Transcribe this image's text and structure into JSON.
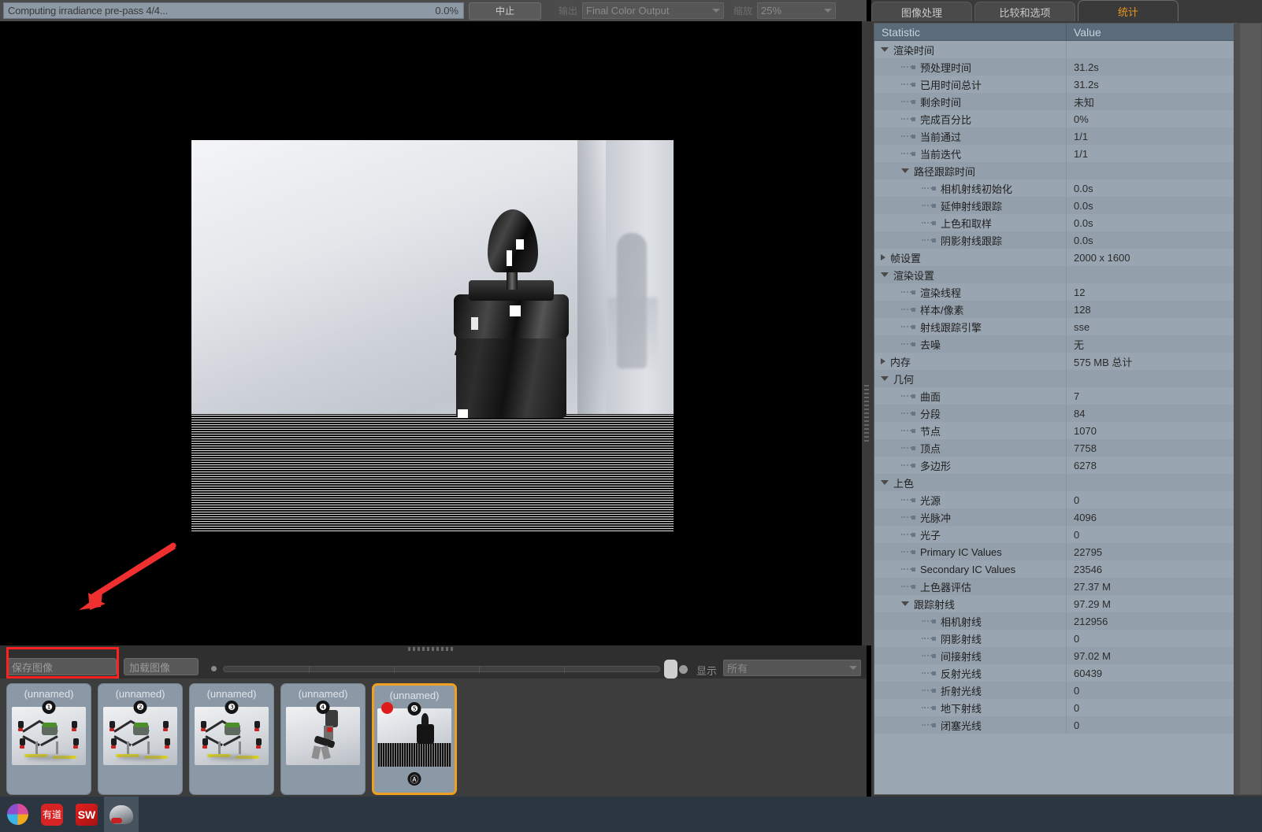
{
  "topbar": {
    "progress_text": "Computing irradiance pre-pass 4/4...",
    "progress_percent": "0.0%",
    "progress_value": 0,
    "abort_label": "中止",
    "output_label": "输出",
    "output_value": "Final Color Output",
    "zoom_label": "缩放",
    "zoom_value": "25%"
  },
  "toolbar": {
    "save_image_label": "保存图像",
    "load_image_label": "加载图像",
    "show_label": "显示",
    "show_value": "所有"
  },
  "thumbnails": [
    {
      "title": "(unnamed)",
      "number": "❶",
      "kind": "drone",
      "selected": false,
      "rendering": false,
      "bottom_badge": ""
    },
    {
      "title": "(unnamed)",
      "number": "❷",
      "kind": "drone",
      "selected": false,
      "rendering": false,
      "bottom_badge": ""
    },
    {
      "title": "(unnamed)",
      "number": "❸",
      "kind": "drone",
      "selected": false,
      "rendering": false,
      "bottom_badge": ""
    },
    {
      "title": "(unnamed)",
      "number": "❹",
      "kind": "arm",
      "selected": false,
      "rendering": false,
      "bottom_badge": ""
    },
    {
      "title": "(unnamed)",
      "number": "❺",
      "kind": "motor",
      "selected": true,
      "rendering": true,
      "bottom_badge": "Ⓐ"
    }
  ],
  "tabs": [
    {
      "label": "图像处理",
      "active": false
    },
    {
      "label": "比较和选项",
      "active": false
    },
    {
      "label": "统计",
      "active": true
    }
  ],
  "table": {
    "headers": {
      "statistic": "Statistic",
      "value": "Value"
    },
    "rows": [
      {
        "label": "渲染时间",
        "value": "",
        "depth": 0,
        "node": "open"
      },
      {
        "label": "预处理时间",
        "value": "31.2s",
        "depth": 1,
        "node": "leaf"
      },
      {
        "label": "已用时间总计",
        "value": "31.2s",
        "depth": 1,
        "node": "leaf"
      },
      {
        "label": "剩余时间",
        "value": "未知",
        "depth": 1,
        "node": "leaf"
      },
      {
        "label": "完成百分比",
        "value": "0%",
        "depth": 1,
        "node": "leaf"
      },
      {
        "label": "当前通过",
        "value": "1/1",
        "depth": 1,
        "node": "leaf"
      },
      {
        "label": "当前迭代",
        "value": "1/1",
        "depth": 1,
        "node": "leaf"
      },
      {
        "label": "路径跟踪时间",
        "value": "",
        "depth": 1,
        "node": "open"
      },
      {
        "label": "相机射线初始化",
        "value": "0.0s",
        "depth": 2,
        "node": "leaf"
      },
      {
        "label": "延伸射线跟踪",
        "value": "0.0s",
        "depth": 2,
        "node": "leaf"
      },
      {
        "label": "上色和取样",
        "value": "0.0s",
        "depth": 2,
        "node": "leaf"
      },
      {
        "label": "阴影射线跟踪",
        "value": "0.0s",
        "depth": 2,
        "node": "leaf"
      },
      {
        "label": "帧设置",
        "value": "2000 x 1600",
        "depth": 0,
        "node": "closed"
      },
      {
        "label": "渲染设置",
        "value": "",
        "depth": 0,
        "node": "open"
      },
      {
        "label": "渲染线程",
        "value": "12",
        "depth": 1,
        "node": "leaf"
      },
      {
        "label": "样本/像素",
        "value": "128",
        "depth": 1,
        "node": "leaf"
      },
      {
        "label": "射线跟踪引擎",
        "value": "sse",
        "depth": 1,
        "node": "leaf"
      },
      {
        "label": "去噪",
        "value": "无",
        "depth": 1,
        "node": "leaf"
      },
      {
        "label": "内存",
        "value": "575 MB 总计",
        "depth": 0,
        "node": "closed"
      },
      {
        "label": "几何",
        "value": "",
        "depth": 0,
        "node": "open"
      },
      {
        "label": "曲面",
        "value": "7",
        "depth": 1,
        "node": "leaf"
      },
      {
        "label": "分段",
        "value": "84",
        "depth": 1,
        "node": "leaf"
      },
      {
        "label": "节点",
        "value": "1070",
        "depth": 1,
        "node": "leaf"
      },
      {
        "label": "顶点",
        "value": "7758",
        "depth": 1,
        "node": "leaf"
      },
      {
        "label": "多边形",
        "value": "6278",
        "depth": 1,
        "node": "leaf"
      },
      {
        "label": "上色",
        "value": "",
        "depth": 0,
        "node": "open"
      },
      {
        "label": "光源",
        "value": "0",
        "depth": 1,
        "node": "leaf"
      },
      {
        "label": "光脉冲",
        "value": "4096",
        "depth": 1,
        "node": "leaf"
      },
      {
        "label": "光子",
        "value": "0",
        "depth": 1,
        "node": "leaf"
      },
      {
        "label": "Primary IC Values",
        "value": "22795",
        "depth": 1,
        "node": "leaf"
      },
      {
        "label": "Secondary IC Values",
        "value": "23546",
        "depth": 1,
        "node": "leaf"
      },
      {
        "label": "上色器评估",
        "value": "27.37 M",
        "depth": 1,
        "node": "leaf"
      },
      {
        "label": "跟踪射线",
        "value": "97.29 M",
        "depth": 1,
        "node": "open"
      },
      {
        "label": "相机射线",
        "value": "212956",
        "depth": 2,
        "node": "leaf"
      },
      {
        "label": "阴影射线",
        "value": "0",
        "depth": 2,
        "node": "leaf"
      },
      {
        "label": "间接射线",
        "value": "97.02 M",
        "depth": 2,
        "node": "leaf"
      },
      {
        "label": "反射光线",
        "value": "60439",
        "depth": 2,
        "node": "leaf"
      },
      {
        "label": "折射光线",
        "value": "0",
        "depth": 2,
        "node": "leaf"
      },
      {
        "label": "地下射线",
        "value": "0",
        "depth": 2,
        "node": "leaf"
      },
      {
        "label": "闭塞光线",
        "value": "0",
        "depth": 2,
        "node": "leaf"
      }
    ]
  },
  "taskbar": {
    "items": [
      {
        "icon": "flower-logo-icon",
        "label": "",
        "active": false
      },
      {
        "icon": "youdao-icon",
        "label": "有道",
        "active": false
      },
      {
        "icon": "solidworks-icon",
        "label": "SW",
        "active": false
      },
      {
        "icon": "keyshot-helmet-icon",
        "label": "",
        "active": true
      }
    ]
  },
  "annotations": {
    "highlight_color": "#ff2020",
    "arrow_color": "#f03030"
  }
}
